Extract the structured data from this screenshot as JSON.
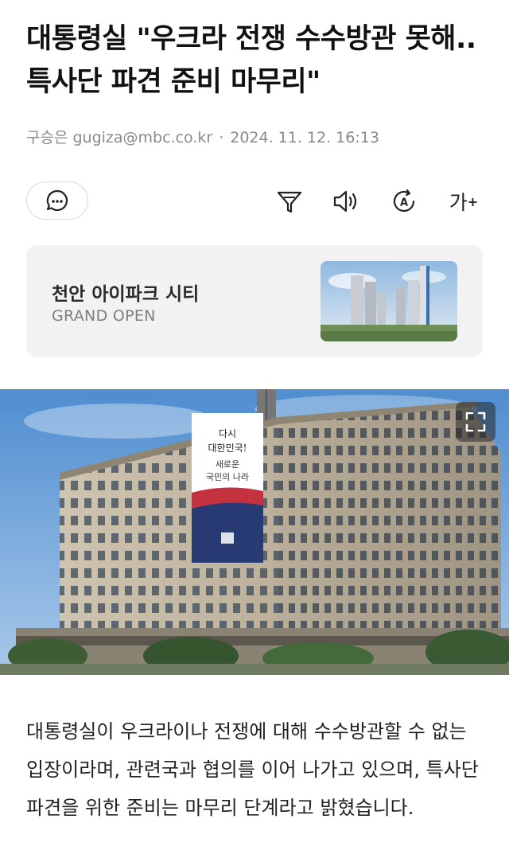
{
  "article": {
    "title": "대통령실 \"우크라 전쟁 수수방관 못해..특사단 파견 준비 마무리\"",
    "author": "구승은 gugiza@mbc.co.kr",
    "separator": "·",
    "date": "2024. 11. 12. 16:13",
    "body": "대통령실이 우크라이나 전쟁에 대해 수수방관할 수 없는 입장이라며, 관련국과 협의를 이어 나가고 있으며, 특사단 파견을 위한 준비는 마무리 단계라고 밝혔습니다."
  },
  "toolbar": {
    "comment_icon": "comment-icon",
    "filter_icon": "summary-filter-icon",
    "audio_icon": "speaker-icon",
    "translate_icon": "translate-icon",
    "font_size_label": "가",
    "font_size_sup": "+"
  },
  "ad": {
    "title": "천안 아이파크 시티",
    "subtitle": "GRAND OPEN"
  },
  "photo": {
    "banner_line1": "다시",
    "banner_line2": "대한민국!",
    "banner_line3": "새로운",
    "banner_line4": "국민의 나라",
    "expand_icon": "expand-icon"
  },
  "colors": {
    "text": "#1a1a1a",
    "meta": "#8a8a8a",
    "ad_bg": "#f2f2f4",
    "banner_navy": "#283a73",
    "banner_red": "#c4323f"
  }
}
